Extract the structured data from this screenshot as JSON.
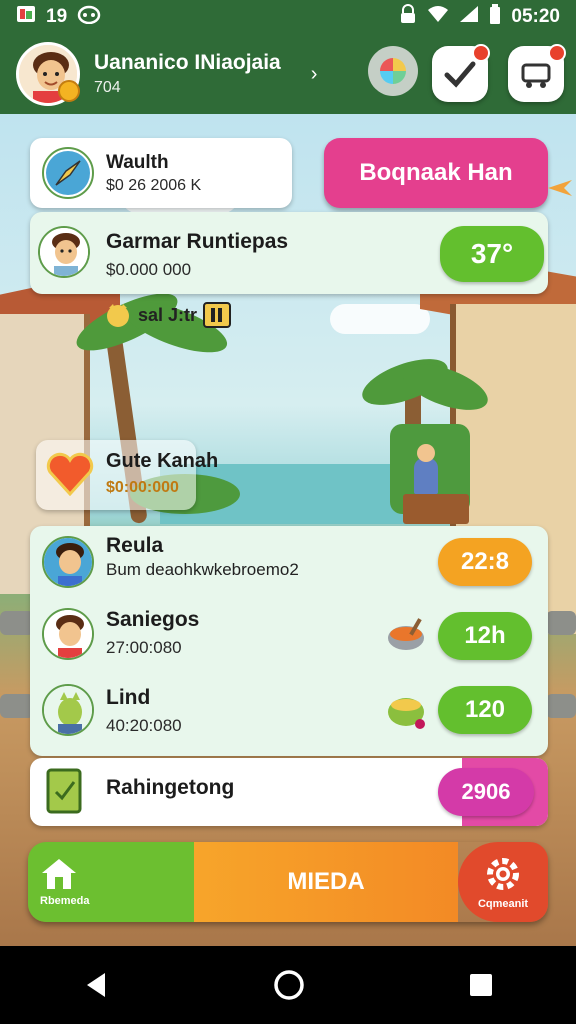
{
  "status_bar": {
    "notif_count": "19",
    "time": "05:20"
  },
  "header": {
    "user_name": "Uananico INiaojaia",
    "user_sub": "704",
    "chevron": "›"
  },
  "cards": {
    "wealth": {
      "title": "Waulth",
      "value": "$0 26 2006 K"
    },
    "action_button": "Boqnaak Han",
    "profile": {
      "title": "Garmar Runtiepas",
      "value": "$0.000 000",
      "badge": "37°"
    },
    "small_badge": "sal J:tr",
    "heart": {
      "title": "Gute Kanah",
      "value": "$0:00:000"
    }
  },
  "list": [
    {
      "title": "Reula",
      "subtitle": "Bum deaohkwkebroemo2",
      "badge": "22:8",
      "badge_color": "orange"
    },
    {
      "title": "Saniegos",
      "subtitle": "27:00:080",
      "badge": "12h",
      "badge_color": "green"
    },
    {
      "title": "Lind",
      "subtitle": "40:20:080",
      "badge": "120",
      "badge_color": "green"
    }
  ],
  "footer_card": {
    "title": "Rahingetong",
    "badge": "2906"
  },
  "bottom_nav": {
    "home_label": "Rbemeda",
    "middle_label": "MIEDA",
    "settings_label": "Cqmeanit"
  },
  "colors": {
    "header_green": "#2f6b37",
    "pill_green": "#63bf2e",
    "pill_orange": "#f4a322",
    "accent_pink": "#e43f8e"
  }
}
